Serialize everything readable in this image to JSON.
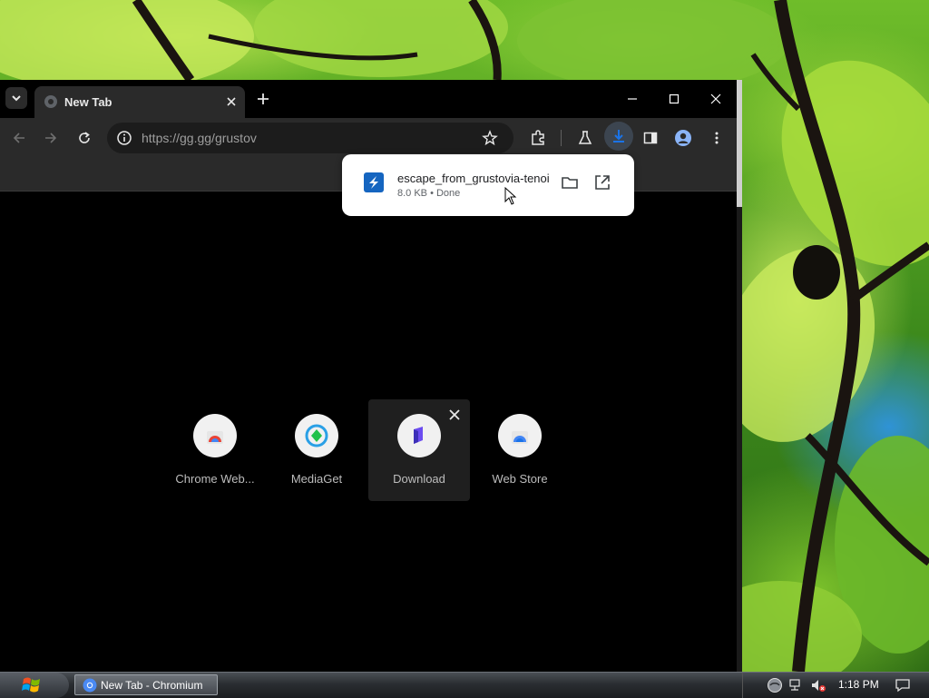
{
  "browser": {
    "tab_title": "New Tab",
    "url": "https://gg.gg/grustov"
  },
  "download": {
    "filename": "escape_from_grustovia-tenoi",
    "status": "8.0 KB • Done"
  },
  "shortcuts": [
    {
      "label": "Chrome Web...",
      "icon": "chrome-web-store-icon"
    },
    {
      "label": "MediaGet",
      "icon": "mediaget-icon"
    },
    {
      "label": "Download",
      "icon": "download-app-icon"
    },
    {
      "label": "Web Store",
      "icon": "web-store-icon"
    }
  ],
  "taskbar": {
    "task_label": "New Tab - Chromium",
    "clock": "1:18 PM"
  },
  "colors": {
    "accent": "#8ab4f8",
    "tab_bg": "#2a2a2a",
    "toolbar_bg": "#2a2a2a"
  }
}
